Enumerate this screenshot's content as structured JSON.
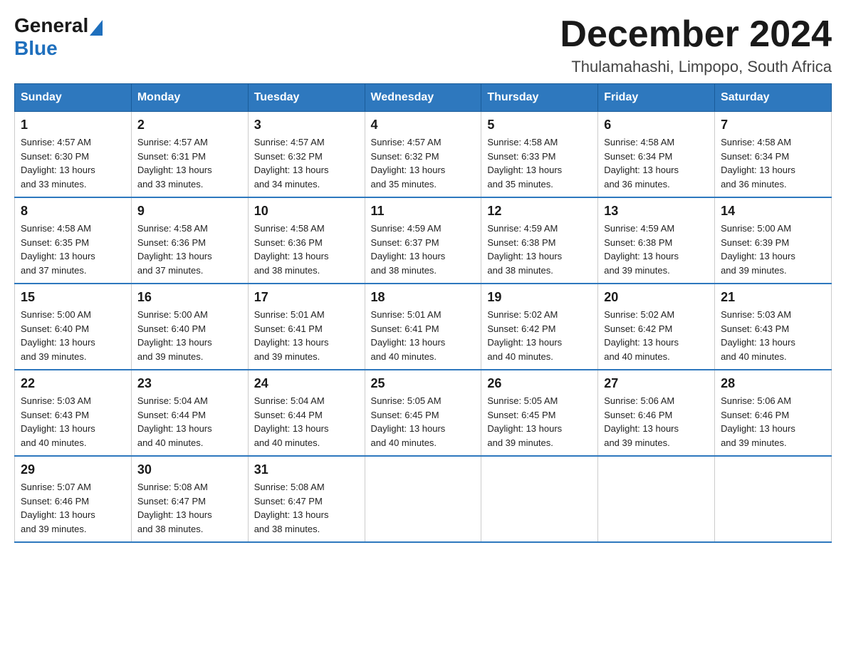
{
  "logo": {
    "general": "General",
    "blue": "Blue"
  },
  "title": "December 2024",
  "subtitle": "Thulamahashi, Limpopo, South Africa",
  "days_of_week": [
    "Sunday",
    "Monday",
    "Tuesday",
    "Wednesday",
    "Thursday",
    "Friday",
    "Saturday"
  ],
  "weeks": [
    [
      {
        "day": "1",
        "sunrise": "4:57 AM",
        "sunset": "6:30 PM",
        "daylight": "13 hours and 33 minutes."
      },
      {
        "day": "2",
        "sunrise": "4:57 AM",
        "sunset": "6:31 PM",
        "daylight": "13 hours and 33 minutes."
      },
      {
        "day": "3",
        "sunrise": "4:57 AM",
        "sunset": "6:32 PM",
        "daylight": "13 hours and 34 minutes."
      },
      {
        "day": "4",
        "sunrise": "4:57 AM",
        "sunset": "6:32 PM",
        "daylight": "13 hours and 35 minutes."
      },
      {
        "day": "5",
        "sunrise": "4:58 AM",
        "sunset": "6:33 PM",
        "daylight": "13 hours and 35 minutes."
      },
      {
        "day": "6",
        "sunrise": "4:58 AM",
        "sunset": "6:34 PM",
        "daylight": "13 hours and 36 minutes."
      },
      {
        "day": "7",
        "sunrise": "4:58 AM",
        "sunset": "6:34 PM",
        "daylight": "13 hours and 36 minutes."
      }
    ],
    [
      {
        "day": "8",
        "sunrise": "4:58 AM",
        "sunset": "6:35 PM",
        "daylight": "13 hours and 37 minutes."
      },
      {
        "day": "9",
        "sunrise": "4:58 AM",
        "sunset": "6:36 PM",
        "daylight": "13 hours and 37 minutes."
      },
      {
        "day": "10",
        "sunrise": "4:58 AM",
        "sunset": "6:36 PM",
        "daylight": "13 hours and 38 minutes."
      },
      {
        "day": "11",
        "sunrise": "4:59 AM",
        "sunset": "6:37 PM",
        "daylight": "13 hours and 38 minutes."
      },
      {
        "day": "12",
        "sunrise": "4:59 AM",
        "sunset": "6:38 PM",
        "daylight": "13 hours and 38 minutes."
      },
      {
        "day": "13",
        "sunrise": "4:59 AM",
        "sunset": "6:38 PM",
        "daylight": "13 hours and 39 minutes."
      },
      {
        "day": "14",
        "sunrise": "5:00 AM",
        "sunset": "6:39 PM",
        "daylight": "13 hours and 39 minutes."
      }
    ],
    [
      {
        "day": "15",
        "sunrise": "5:00 AM",
        "sunset": "6:40 PM",
        "daylight": "13 hours and 39 minutes."
      },
      {
        "day": "16",
        "sunrise": "5:00 AM",
        "sunset": "6:40 PM",
        "daylight": "13 hours and 39 minutes."
      },
      {
        "day": "17",
        "sunrise": "5:01 AM",
        "sunset": "6:41 PM",
        "daylight": "13 hours and 39 minutes."
      },
      {
        "day": "18",
        "sunrise": "5:01 AM",
        "sunset": "6:41 PM",
        "daylight": "13 hours and 40 minutes."
      },
      {
        "day": "19",
        "sunrise": "5:02 AM",
        "sunset": "6:42 PM",
        "daylight": "13 hours and 40 minutes."
      },
      {
        "day": "20",
        "sunrise": "5:02 AM",
        "sunset": "6:42 PM",
        "daylight": "13 hours and 40 minutes."
      },
      {
        "day": "21",
        "sunrise": "5:03 AM",
        "sunset": "6:43 PM",
        "daylight": "13 hours and 40 minutes."
      }
    ],
    [
      {
        "day": "22",
        "sunrise": "5:03 AM",
        "sunset": "6:43 PM",
        "daylight": "13 hours and 40 minutes."
      },
      {
        "day": "23",
        "sunrise": "5:04 AM",
        "sunset": "6:44 PM",
        "daylight": "13 hours and 40 minutes."
      },
      {
        "day": "24",
        "sunrise": "5:04 AM",
        "sunset": "6:44 PM",
        "daylight": "13 hours and 40 minutes."
      },
      {
        "day": "25",
        "sunrise": "5:05 AM",
        "sunset": "6:45 PM",
        "daylight": "13 hours and 40 minutes."
      },
      {
        "day": "26",
        "sunrise": "5:05 AM",
        "sunset": "6:45 PM",
        "daylight": "13 hours and 39 minutes."
      },
      {
        "day": "27",
        "sunrise": "5:06 AM",
        "sunset": "6:46 PM",
        "daylight": "13 hours and 39 minutes."
      },
      {
        "day": "28",
        "sunrise": "5:06 AM",
        "sunset": "6:46 PM",
        "daylight": "13 hours and 39 minutes."
      }
    ],
    [
      {
        "day": "29",
        "sunrise": "5:07 AM",
        "sunset": "6:46 PM",
        "daylight": "13 hours and 39 minutes."
      },
      {
        "day": "30",
        "sunrise": "5:08 AM",
        "sunset": "6:47 PM",
        "daylight": "13 hours and 38 minutes."
      },
      {
        "day": "31",
        "sunrise": "5:08 AM",
        "sunset": "6:47 PM",
        "daylight": "13 hours and 38 minutes."
      },
      null,
      null,
      null,
      null
    ]
  ],
  "labels": {
    "sunrise": "Sunrise:",
    "sunset": "Sunset:",
    "daylight": "Daylight:"
  }
}
